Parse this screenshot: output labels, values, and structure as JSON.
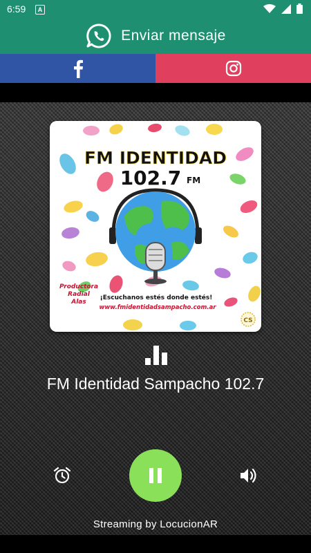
{
  "status_bar": {
    "time": "6:59",
    "notification_letter": "A"
  },
  "whatsapp": {
    "label": "Enviar mensaje",
    "icon": "whatsapp-icon",
    "color": "#1f8f72"
  },
  "social": [
    {
      "name": "facebook",
      "icon": "facebook-icon",
      "color": "#2f55a4"
    },
    {
      "name": "instagram",
      "icon": "instagram-icon",
      "color": "#e0405e"
    }
  ],
  "cover": {
    "title_line1": "FM IDENTIDAD",
    "title_line2": "102.7",
    "title_fm": "FM",
    "producer_line1": "Productora",
    "producer_line2": "Radial",
    "producer_line3": "Alas",
    "tagline": "¡Escuchanos estés donde estés!",
    "website": "www.fmidentidadsampacho.com.ar",
    "badge": "CS"
  },
  "player": {
    "station_name": "FM Identidad Sampacho 102.7",
    "state": "playing",
    "alarm_icon": "alarm-clock-icon",
    "pause_icon": "pause-icon",
    "volume_icon": "volume-icon",
    "accent": "#8be05a"
  },
  "footer": {
    "streaming_text": "Streaming by LocucionAR"
  }
}
